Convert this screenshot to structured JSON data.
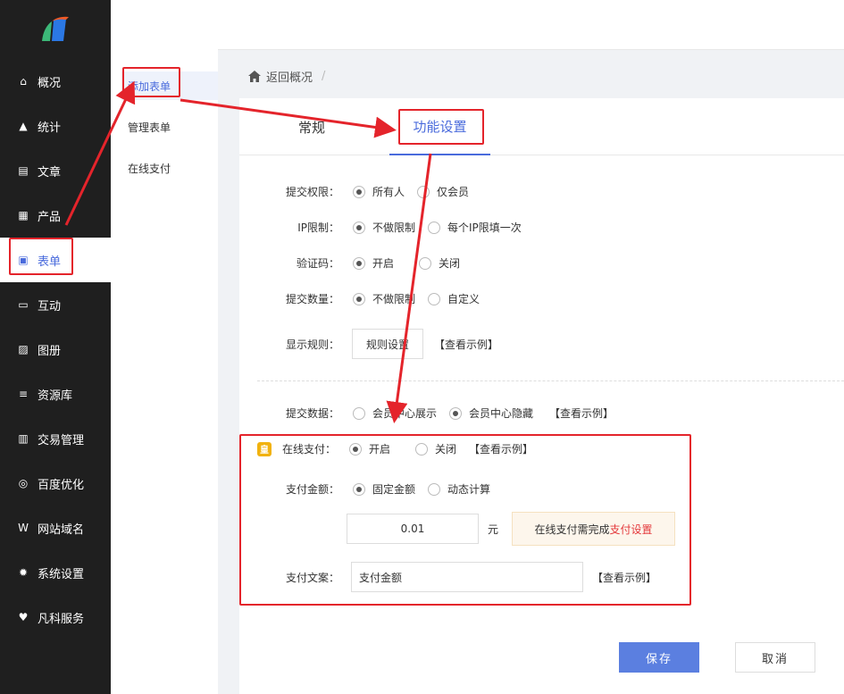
{
  "sidebar": {
    "items": [
      {
        "label": "概况",
        "icon": "home-icon",
        "glyph": "⌂"
      },
      {
        "label": "统计",
        "icon": "chart-icon",
        "glyph": "▲"
      },
      {
        "label": "文章",
        "icon": "article-icon",
        "glyph": "▤"
      },
      {
        "label": "产品",
        "icon": "grid-icon",
        "glyph": "▦"
      },
      {
        "label": "表单",
        "icon": "form-icon",
        "glyph": "▣"
      },
      {
        "label": "互动",
        "icon": "chat-icon",
        "glyph": "▭"
      },
      {
        "label": "图册",
        "icon": "album-icon",
        "glyph": "▨"
      },
      {
        "label": "资源库",
        "icon": "database-icon",
        "glyph": "≡"
      },
      {
        "label": "交易管理",
        "icon": "clipboard-icon",
        "glyph": "▥"
      },
      {
        "label": "百度优化",
        "icon": "target-icon",
        "glyph": "◎"
      },
      {
        "label": "网站域名",
        "icon": "w-icon",
        "glyph": "W"
      },
      {
        "label": "系统设置",
        "icon": "gear-icon",
        "glyph": "✹"
      },
      {
        "label": "凡科服务",
        "icon": "heart-icon",
        "glyph": "♥"
      }
    ]
  },
  "submenu": {
    "items": [
      "添加表单",
      "管理表单",
      "在线支付"
    ]
  },
  "breadcrumb": {
    "back": "返回概况",
    "sep": "/"
  },
  "tabs": {
    "general": "常规",
    "feature": "功能设置"
  },
  "form": {
    "permission": {
      "label": "提交权限：",
      "opt1": "所有人",
      "opt2": "仅会员"
    },
    "ip": {
      "label": "IP限制：",
      "opt1": "不做限制",
      "opt2": "每个IP限填一次"
    },
    "captcha": {
      "label": "验证码：",
      "opt1": "开启",
      "opt2": "关闭"
    },
    "count": {
      "label": "提交数量：",
      "opt1": "不做限制",
      "opt2": "自定义"
    },
    "display": {
      "label": "显示规则：",
      "button": "规则设置",
      "example": "【查看示例】"
    },
    "submitdata": {
      "label": "提交数据：",
      "opt1": "会员中心展示",
      "opt2": "会员中心隐藏",
      "example": "【查看示例】"
    },
    "payment": {
      "vip": "皇",
      "label": "在线支付：",
      "opt1": "开启",
      "opt2": "关闭",
      "example": "【查看示例】"
    },
    "amount": {
      "label": "支付金额：",
      "opt1": "固定金额",
      "opt2": "动态计算",
      "value": "0.01",
      "unit": "元"
    },
    "notice": {
      "text": "在线支付需完成",
      "link": "支付设置"
    },
    "copy": {
      "label": "支付文案：",
      "value": "支付金额",
      "example": "【查看示例】"
    }
  },
  "actions": {
    "save": "保存",
    "cancel": "取消"
  }
}
